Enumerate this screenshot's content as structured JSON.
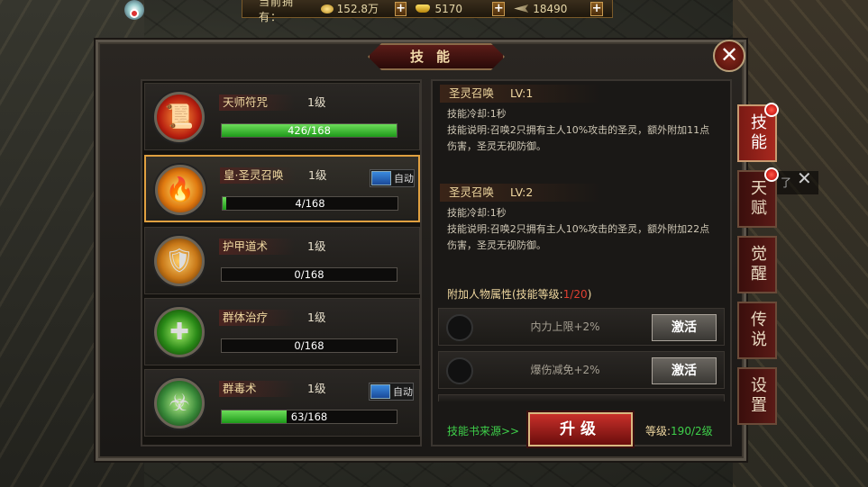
{
  "resources": {
    "label": "当前拥有：",
    "items": [
      {
        "name": "coin",
        "icon": "coin-icon",
        "value": "152.8万"
      },
      {
        "name": "ingot",
        "icon": "gold-ingot-icon",
        "value": "5170"
      },
      {
        "name": "feather",
        "icon": "feather-icon",
        "value": "18490"
      }
    ],
    "plus_label": "+"
  },
  "window": {
    "title": "技能",
    "close_label": "✕"
  },
  "skills": [
    {
      "name": "天师符咒",
      "level": "1级",
      "progress_text": "426/168",
      "progress_pct": 100,
      "auto": false,
      "icon": "talisman-icon"
    },
    {
      "name": "皇·圣灵召唤",
      "level": "1级",
      "progress_text": "4/168",
      "progress_pct": 2,
      "auto": true,
      "auto_label": "自动",
      "icon": "phoenix-summon-icon"
    },
    {
      "name": "护甲道术",
      "level": "1级",
      "progress_text": "0/168",
      "progress_pct": 0,
      "auto": false,
      "icon": "armor-spell-icon"
    },
    {
      "name": "群体治疗",
      "level": "1级",
      "progress_text": "0/168",
      "progress_pct": 0,
      "auto": false,
      "icon": "group-heal-icon"
    },
    {
      "name": "群毒术",
      "level": "1级",
      "progress_text": "63/168",
      "progress_pct": 37,
      "auto": true,
      "auto_label": "自动",
      "icon": "poison-spell-icon"
    }
  ],
  "detail": {
    "current": {
      "name": "圣灵召唤",
      "lv": "LV:1",
      "cooldown": "技能冷却:1秒",
      "desc": "技能说明:召唤2只拥有主人10%攻击的圣灵，额外附加11点伤害，圣灵无视防御。"
    },
    "next": {
      "name": "圣灵召唤",
      "lv": "LV:2",
      "cooldown": "技能冷却:1秒",
      "desc": "技能说明:召唤2只拥有主人10%攻击的圣灵，额外附加22点伤害，圣灵无视防御。"
    },
    "attr_title": "附加人物属性(技能等级:",
    "attr_level": "1/20",
    "attr_close": ")",
    "attrs": [
      {
        "text": "内力上限+2%",
        "button": "激活"
      },
      {
        "text": "爆伤减免+2%",
        "button": "激活"
      }
    ],
    "source_link": "技能书来源>>",
    "upgrade_label": "升级",
    "level_label": "等级:",
    "level_value": "190/2级"
  },
  "tabs": [
    {
      "label": "技能",
      "active": true,
      "dot": true
    },
    {
      "label": "天赋",
      "active": false,
      "dot": true
    },
    {
      "label": "觉醒",
      "active": false,
      "dot": false
    },
    {
      "label": "传说",
      "active": false,
      "dot": false
    },
    {
      "label": "设置",
      "active": false,
      "dot": false
    }
  ],
  "side_note": "了"
}
